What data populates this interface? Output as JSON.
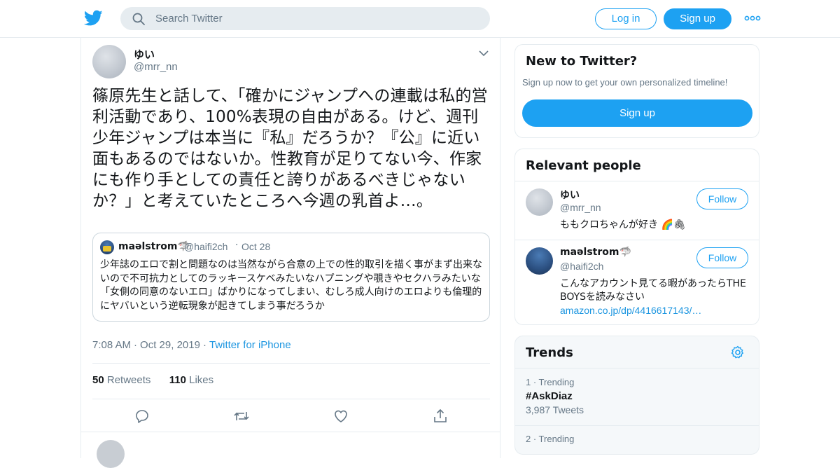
{
  "header": {
    "search_placeholder": "Search Twitter",
    "login_label": "Log in",
    "signup_label": "Sign up",
    "logo_icon": "twitter-bird-icon",
    "more_icon": "more-dots-icon",
    "accent_color": "#1da1f2"
  },
  "tweet": {
    "author_name": "ゆい",
    "author_handle": "@mrr_nn",
    "text": "篠原先生と話して、「確かにジャンプへの連載は私的営利活動であり、100%表現の自由がある。けど、週刊少年ジャンプは本当に『私』だろうか？『公』に近い面もあるのではないか。性教育が足りてない今、作家にも作り手としての責任と誇りがあるべきじゃないか？」と考えていたところへ今週の乳首よ…。",
    "quote": {
      "name": "maəlstrom🦈",
      "handle": "@haifi2ch",
      "dot": "·",
      "date": "Oct 28",
      "text": "少年誌のエロで割と問題なのは当然ながら合意の上での性的取引を描く事がまず出来ないので不可抗力としてのラッキースケベみたいなハプニングや覗きやセクハラみたいな「女側の同意のないエロ」ばかりになってしまい、むしろ成人向けのエロよりも倫理的にヤバいという逆転現象が起きてしまう事だろうか"
    },
    "time": "7:08 AM",
    "date": "Oct 29, 2019",
    "source": "Twitter for iPhone",
    "separator": "·",
    "retweets_count": "50",
    "retweets_label": "Retweets",
    "likes_count": "110",
    "likes_label": "Likes",
    "actions": [
      "reply-icon",
      "retweet-icon",
      "like-icon",
      "share-icon"
    ]
  },
  "sidebar": {
    "new_to_twitter": {
      "title": "New to Twitter?",
      "subtitle": "Sign up now to get your own personalized timeline!",
      "signup_label": "Sign up"
    },
    "relevant_people": {
      "title": "Relevant people",
      "people": [
        {
          "name": "ゆい",
          "handle": "@mrr_nn",
          "bio": "ももクロちゃんが好き 🌈🖇",
          "follow_label": "Follow"
        },
        {
          "name": "maəlstrom🦈",
          "handle": "@haifi2ch",
          "bio": "こんなアカウント見てる暇があったらTHE BOYSを読みなさい",
          "link": "amazon.co.jp/dp/4416617143/…",
          "follow_label": "Follow"
        }
      ]
    },
    "trends": {
      "title": "Trends",
      "gear_icon": "gear-icon",
      "items": [
        {
          "rank": "1 · Trending",
          "tag": "#AskDiaz",
          "count": "3,987 Tweets"
        },
        {
          "rank": "2 · Trending",
          "tag": "",
          "count": ""
        }
      ]
    }
  }
}
